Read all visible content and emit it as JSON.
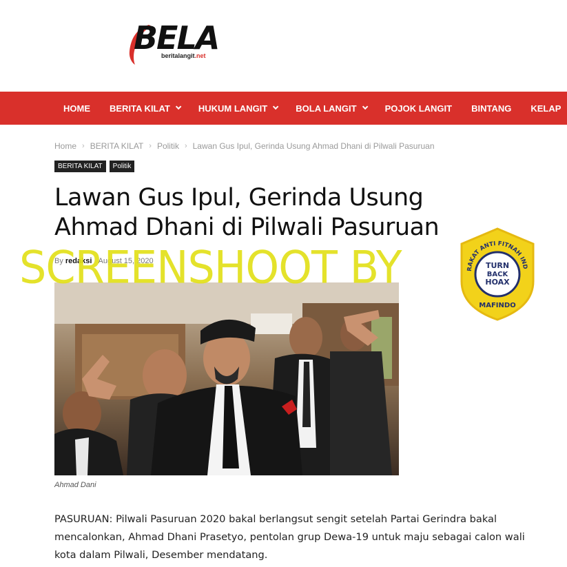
{
  "logo": {
    "text": "BELA",
    "sub_prefix": "beritalangit",
    "sub_suffix": ".net"
  },
  "nav": {
    "items": [
      {
        "label": "HOME",
        "dropdown": false
      },
      {
        "label": "BERITA KILAT",
        "dropdown": true
      },
      {
        "label": "HUKUM LANGIT",
        "dropdown": true
      },
      {
        "label": "BOLA LANGIT",
        "dropdown": true
      },
      {
        "label": "POJOK LANGIT",
        "dropdown": false
      },
      {
        "label": "BINTANG",
        "dropdown": false
      },
      {
        "label": "KELAP",
        "dropdown": false
      }
    ]
  },
  "breadcrumb": [
    "Home",
    "BERITA KILAT",
    "Politik",
    "Lawan Gus Ipul, Gerinda Usung Ahmad Dhani di Pilwali Pasuruan"
  ],
  "tags": [
    "BERITA KILAT",
    "Politik"
  ],
  "article": {
    "title": "Lawan Gus Ipul, Gerinda Usung Ahmad Dhani di Pilwali Pasuruan",
    "by_label": "By",
    "author": "redaksi",
    "date": "August 15, 2020",
    "image_caption": "Ahmad Dani",
    "body": "PASURUAN: Pilwali Pasuruan 2020 bakal berlangsut sengit setelah Partai Gerindra bakal mencalonkan, Ahmad Dhani Prasetyo, pentolan grup Dewa-19 untuk maju sebagai calon wali kota dalam Pilwali, Desember mendatang."
  },
  "watermark": {
    "text": "SCREENSHOOT BY"
  },
  "badge": {
    "arc_text": "MASYARAKAT ANTI FITNAH INDONESIA",
    "line1": "TURN",
    "line2": "BACK",
    "line3": "HOAX",
    "bottom": "MAFINDO"
  },
  "colors": {
    "brand": "#d9302b",
    "watermark": "#e2e01a",
    "badge_fill": "#f2d21a",
    "badge_navy": "#23306b"
  }
}
